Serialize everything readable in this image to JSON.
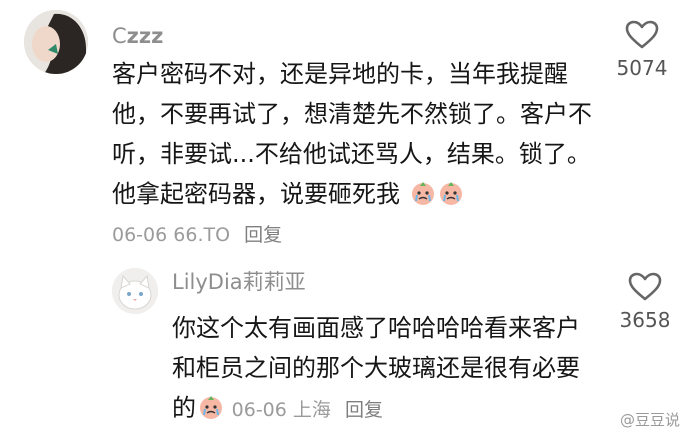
{
  "comments": [
    {
      "username": "C",
      "username_suffix": "zzz",
      "text": "客户密码不对，还是异地的卡，当年我提醒他，不要再试了，想清楚先不然锁了。客户不听，非要试...不给他试还骂人，结果。锁了。他拿起密码器，说要砸死我",
      "date": "06-06",
      "location": "66.TO",
      "reply_label": "回复",
      "like_count": "5074"
    },
    {
      "username": "LilyDia莉莉亚",
      "text": "你这个太有画面感了哈哈哈哈看来客户和柜员之间的那个大玻璃还是很有必要的",
      "date": "06-06",
      "location": "上海",
      "reply_label": "回复",
      "like_count": "3658"
    }
  ],
  "watermark": "@豆豆说",
  "icons": {
    "like": "heart-outline-icon",
    "emoji": "crying-face-icon"
  }
}
